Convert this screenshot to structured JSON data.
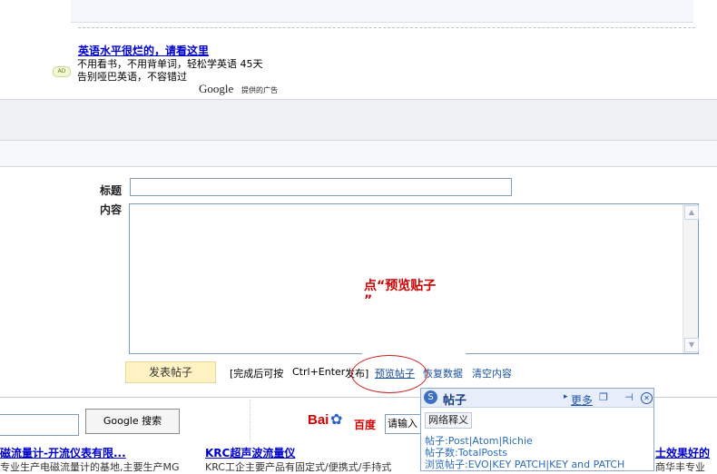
{
  "ad": {
    "badge": "AD",
    "title": "英语水平很烂的，请看这里",
    "line1": "不用看书，不用背单词，轻松学英语 45天",
    "line2": "告别哑巴英语，不容错过",
    "google": "Google",
    "provided": "提供的广告"
  },
  "form": {
    "title_label": "标题",
    "content_label": "内容",
    "annotation_line1": "点“预览贴子",
    "annotation_line2": "”",
    "post_button": "发表帖子",
    "hint": "[完成后可按",
    "shortcut": "Ctrl+Enter",
    "publish": "发布]",
    "preview": "预览帖子",
    "restore": "恢复数据",
    "clear": "清空内容"
  },
  "search": {
    "google_button": "Google 搜索",
    "baidu_logo": "Bai",
    "baidu_logo_cn": "百度",
    "baidu_placeholder": "请输入"
  },
  "bottom_ads": [
    {
      "title": "磁流量计-开流仪表有限...",
      "desc": "专业生产电磁流量计的基地,主要生产MG"
    },
    {
      "title": "KRC超声波流量仪",
      "desc": "KRC工企主要产品有固定式/便携式/手持式"
    },
    {
      "title": "士效果好的",
      "desc": "商华丰专业"
    }
  ],
  "popup": {
    "title": "帖子",
    "more": "更多",
    "tab": "网络释义",
    "line1": "帖子:Post|Atom|Richie",
    "line2": "帖子数:TotalPosts",
    "line3": "浏览帖子:EVO|KEY PATCH|KEY and PATCH"
  }
}
